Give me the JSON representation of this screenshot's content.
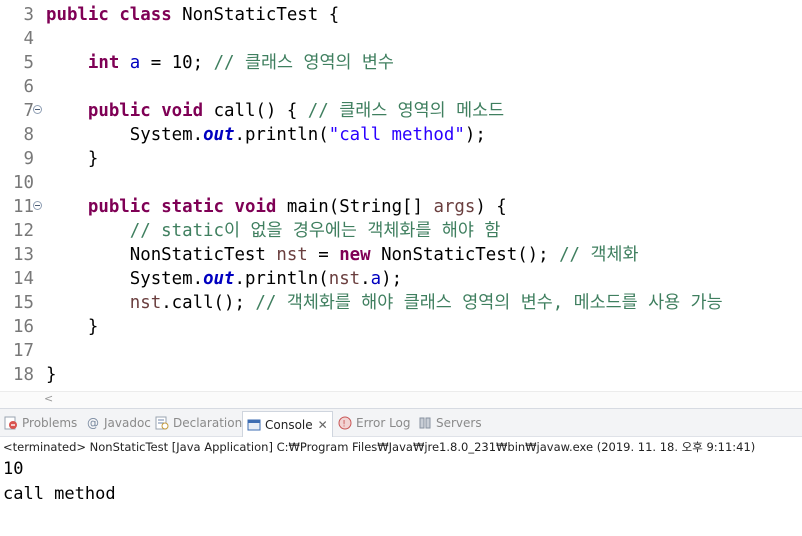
{
  "editor": {
    "lines": [
      {
        "num": "3",
        "fold": false,
        "segments": [
          [
            "kw",
            "public"
          ],
          [
            "",
            " "
          ],
          [
            "kw",
            "class"
          ],
          [
            "",
            " NonStaticTest {"
          ]
        ]
      },
      {
        "num": "4",
        "fold": false,
        "segments": []
      },
      {
        "num": "5",
        "fold": false,
        "segments": [
          [
            "",
            "    "
          ],
          [
            "kw",
            "int"
          ],
          [
            "",
            " "
          ],
          [
            "fd",
            "a"
          ],
          [
            "",
            " = 10; "
          ],
          [
            "cm",
            "// 클래스 영역의 변수"
          ]
        ]
      },
      {
        "num": "6",
        "fold": false,
        "segments": []
      },
      {
        "num": "7",
        "fold": true,
        "segments": [
          [
            "",
            "    "
          ],
          [
            "kw",
            "public"
          ],
          [
            "",
            " "
          ],
          [
            "kw",
            "void"
          ],
          [
            "",
            " call() { "
          ],
          [
            "cm",
            "// 클래스 영역의 메소드"
          ]
        ]
      },
      {
        "num": "8",
        "fold": false,
        "segments": [
          [
            "",
            "        System."
          ],
          [
            "sf",
            "out"
          ],
          [
            "",
            ".println("
          ],
          [
            "st",
            "\"call method\""
          ],
          [
            "",
            ");"
          ]
        ]
      },
      {
        "num": "9",
        "fold": false,
        "segments": [
          [
            "",
            "    }"
          ]
        ]
      },
      {
        "num": "10",
        "fold": false,
        "segments": []
      },
      {
        "num": "11",
        "fold": true,
        "segments": [
          [
            "",
            "    "
          ],
          [
            "kw",
            "public"
          ],
          [
            "",
            " "
          ],
          [
            "kw",
            "static"
          ],
          [
            "",
            " "
          ],
          [
            "kw",
            "void"
          ],
          [
            "",
            " main(String[] "
          ],
          [
            "vr",
            "args"
          ],
          [
            "",
            ") {"
          ]
        ]
      },
      {
        "num": "12",
        "fold": false,
        "segments": [
          [
            "",
            "        "
          ],
          [
            "cm",
            "// static이 없을 경우에는 객체화를 해야 함"
          ]
        ]
      },
      {
        "num": "13",
        "fold": false,
        "segments": [
          [
            "",
            "        NonStaticTest "
          ],
          [
            "vr",
            "nst"
          ],
          [
            "",
            " = "
          ],
          [
            "kw",
            "new"
          ],
          [
            "",
            " NonStaticTest(); "
          ],
          [
            "cm",
            "// 객체화"
          ]
        ]
      },
      {
        "num": "14",
        "fold": false,
        "segments": [
          [
            "",
            "        System."
          ],
          [
            "sf",
            "out"
          ],
          [
            "",
            ".println("
          ],
          [
            "vr",
            "nst"
          ],
          [
            "",
            "."
          ],
          [
            "fd",
            "a"
          ],
          [
            "",
            ");"
          ]
        ]
      },
      {
        "num": "15",
        "fold": false,
        "segments": [
          [
            "",
            "        "
          ],
          [
            "vr",
            "nst"
          ],
          [
            "",
            ".call(); "
          ],
          [
            "cm",
            "// 객체화를 해야 클래스 영역의 변수, 메소드를 사용 가능"
          ]
        ]
      },
      {
        "num": "16",
        "fold": false,
        "segments": [
          [
            "",
            "    }"
          ]
        ]
      },
      {
        "num": "17",
        "fold": false,
        "segments": []
      },
      {
        "num": "18",
        "fold": false,
        "segments": [
          [
            "",
            "}"
          ]
        ]
      }
    ],
    "scroll_arrow": "<"
  },
  "views": {
    "tabs": [
      {
        "name": "problems",
        "label": "Problems",
        "icon": "problems-icon",
        "active": false
      },
      {
        "name": "javadoc",
        "label": "Javadoc",
        "icon": "javadoc-icon",
        "active": false
      },
      {
        "name": "declaration",
        "label": "Declaration",
        "icon": "declaration-icon",
        "active": false
      },
      {
        "name": "console",
        "label": "Console",
        "icon": "console-icon",
        "active": true,
        "close": "✕"
      },
      {
        "name": "error-log",
        "label": "Error Log",
        "icon": "error-log-icon",
        "active": false
      },
      {
        "name": "servers",
        "label": "Servers",
        "icon": "servers-icon",
        "active": false
      }
    ]
  },
  "console": {
    "header": "<terminated> NonStaticTest [Java Application] C:₩Program Files₩Java₩jre1.8.0_231₩bin₩javaw.exe (2019. 11. 18. 오후 9:11:41)",
    "output": [
      "10",
      "call method"
    ]
  },
  "colors": {
    "keyword": "#7f0055",
    "comment": "#3f7f5f",
    "string": "#2a00ff",
    "field": "#0000c0",
    "local_variable": "#6a3e3e",
    "line_number": "#787878"
  }
}
